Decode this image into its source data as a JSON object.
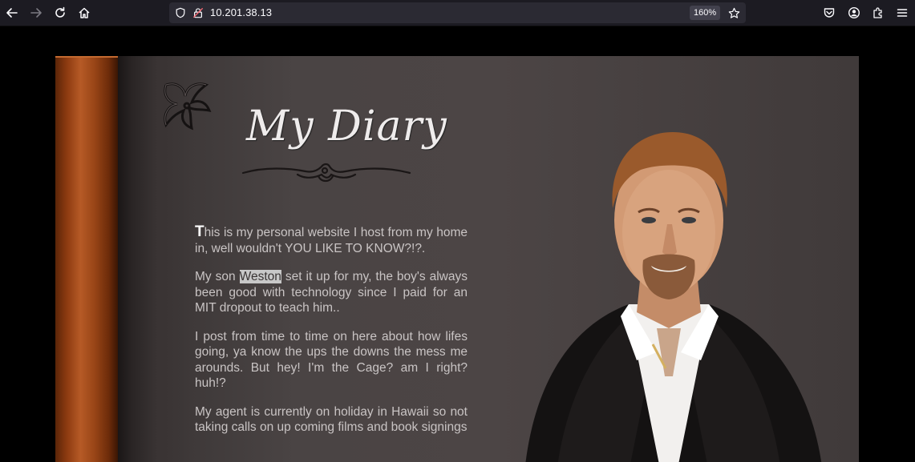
{
  "browser": {
    "url": "10.201.38.13",
    "zoom": "160%",
    "icons": [
      "back-icon",
      "forward-icon",
      "reload-icon",
      "home-icon",
      "shield-icon",
      "lock-icon",
      "bookmark-star-icon",
      "pocket-icon",
      "account-icon",
      "extensions-icon",
      "menu-icon"
    ]
  },
  "page": {
    "title": "My Diary",
    "paragraphs": {
      "p1_dropcap": "T",
      "p1_rest": "his is my personal website I host from my home in, well wouldn't YOU LIKE TO KNOW?!?.",
      "p2_before": "My son ",
      "p2_highlight": "Weston",
      "p2_after": " set it up for my, the boy's always been good with technology since I paid for an MIT dropout to teach him..",
      "p3": "I post from time to time on here about how lifes going, ya know the ups the downs the mess me arounds. But hey! I'm the Cage? am I right? huh!?",
      "p4": "My agent is currently on holiday in Hawaii so not taking calls on up coming films and book signings"
    },
    "colors": {
      "page_bg": "#000000",
      "book_bg": "#4a4444",
      "spine": "#b65a26",
      "text": "#c9c4c4"
    }
  }
}
